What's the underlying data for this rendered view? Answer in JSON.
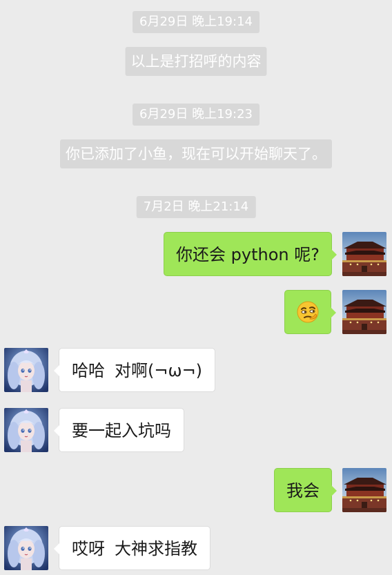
{
  "chat": {
    "system_messages": [
      {
        "kind": "time",
        "text": "6月29日 晚上19:14"
      },
      {
        "kind": "note",
        "text": "以上是打招呼的内容"
      },
      {
        "kind": "time",
        "text": "6月29日 晚上19:23"
      },
      {
        "kind": "note",
        "text": "你已添加了小鱼，现在可以开始聊天了。"
      },
      {
        "kind": "time",
        "text": "7月2日 晚上21:14"
      }
    ],
    "messages": [
      {
        "from": "me",
        "type": "text",
        "text": "你还会 python 呢?"
      },
      {
        "from": "me",
        "type": "emoji",
        "emoji": "thinking-face-icon"
      },
      {
        "from": "friend",
        "type": "text",
        "part1": "哈哈",
        "part2": "对啊(¬ω¬)"
      },
      {
        "from": "friend",
        "type": "text",
        "text": "要一起入坑吗"
      },
      {
        "from": "me",
        "type": "text",
        "text": "我会"
      },
      {
        "from": "friend",
        "type": "text",
        "part1": "哎呀",
        "part2": "大神求指教"
      }
    ],
    "colors": {
      "background": "#ebebeb",
      "outgoing_bubble": "#9fe658",
      "incoming_bubble": "#ffffff",
      "system_pill": "#d8d8d8"
    },
    "avatars": {
      "me": "gate-tower-photo-avatar",
      "friend": "anime-girl-avatar"
    }
  }
}
